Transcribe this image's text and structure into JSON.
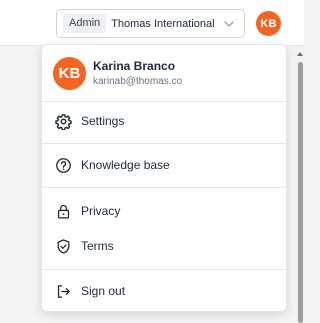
{
  "topbar": {
    "role_badge": "Admin",
    "org_name": "Thomas International",
    "avatar_initials": "KB"
  },
  "menu": {
    "user": {
      "initials": "KB",
      "name": "Karina Branco",
      "email": "karinab@thomas.co"
    },
    "items": [
      {
        "label": "Settings",
        "icon": "gear-icon"
      },
      {
        "label": "Knowledge base",
        "icon": "question-circle-icon"
      },
      {
        "label": "Privacy",
        "icon": "lock-icon"
      },
      {
        "label": "Terms",
        "icon": "shield-check-icon"
      },
      {
        "label": "Sign out",
        "icon": "sign-out-icon"
      }
    ]
  },
  "colors": {
    "avatar": "#f26522",
    "border": "#e5e7eb",
    "text": "#1f2937",
    "muted": "#6b7280"
  }
}
